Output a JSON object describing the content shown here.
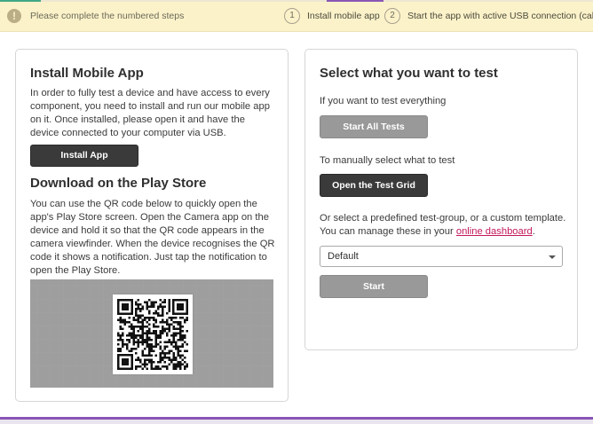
{
  "notice": {
    "icon": "warning-icon",
    "icon_glyph": "!",
    "text": "Please complete the numbered steps",
    "steps": [
      {
        "number": "1",
        "label": "Install mobile app"
      },
      {
        "number": "2",
        "label": "Start the app with active USB connection (cable)"
      }
    ]
  },
  "left": {
    "install_title": "Install Mobile App",
    "install_text": "In order to fully test a device and have access to every component, you need to install and run our mobile app on it. Once installed, please open it and have the device connected to your computer via USB.",
    "install_button": "Install App",
    "download_title": "Download on the Play Store",
    "download_text": "You can use the QR code below to quickly open the app's Play Store screen. Open the Camera app on the device and hold it so that the QR code appears in the camera viewfinder. When the device recognises the QR code it shows a notification. Just tap the notification to open the Play Store."
  },
  "right": {
    "title": "Select what you want to test",
    "everything_text": "If you want to test everything",
    "start_all_button": "Start All Tests",
    "manual_text": "To manually select what to test",
    "test_grid_button": "Open the Test Grid",
    "predefined_text_1": "Or select a predefined test-group, or a custom template. You can manage these in your ",
    "dashboard_link": "online dashboard",
    "predefined_text_2": ".",
    "select_value": "Default",
    "start_button": "Start"
  },
  "colors": {
    "notice_bg": "#fbf2c9",
    "dark_button": "#3a3a3a",
    "gray_button": "#999999",
    "link": "#c2185b",
    "accent": "#8a55b6"
  }
}
